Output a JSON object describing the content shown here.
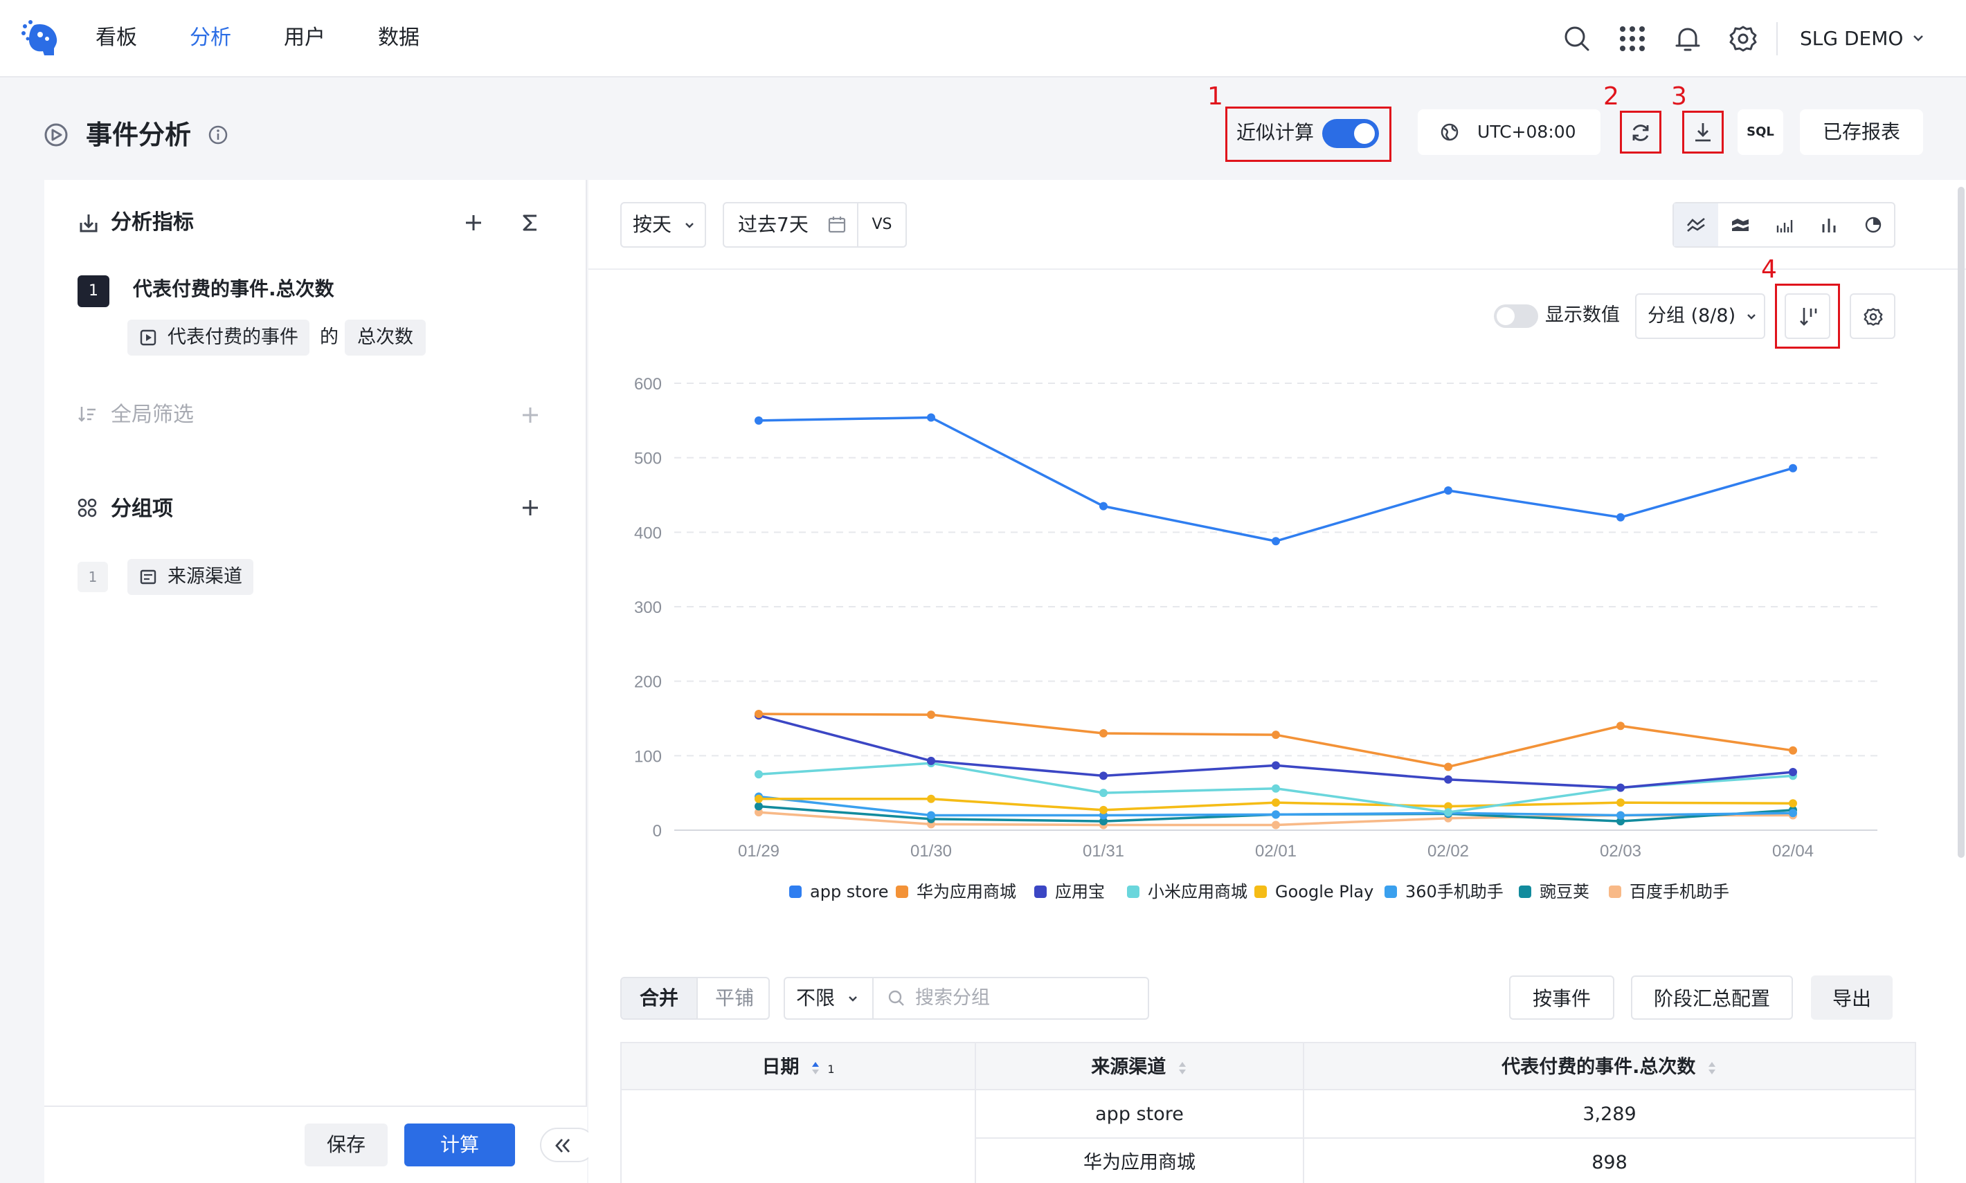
{
  "nav": {
    "items": [
      "看板",
      "分析",
      "用户",
      "数据"
    ],
    "active_index": 1,
    "user": "SLG DEMO"
  },
  "header": {
    "title": "事件分析",
    "approx_label": "近似计算",
    "approx_on": true,
    "timezone": "UTC+08:00",
    "sql_label": "SQL",
    "saved_reports": "已存报表"
  },
  "annotations": [
    "1",
    "2",
    "3",
    "4"
  ],
  "left": {
    "metrics_title": "分析指标",
    "metric_index": "1",
    "metric_name": "代表付费的事件.总次数",
    "metric_event": "代表付费的事件",
    "metric_of": "的",
    "metric_agg": "总次数",
    "filter_title": "全局筛选",
    "group_title": "分组项",
    "group_index": "1",
    "group_field": "来源渠道",
    "save": "保存",
    "calc": "计算"
  },
  "toolbar": {
    "granularity": "按天",
    "range": "过去7天",
    "vs": "VS"
  },
  "chart_controls": {
    "show_values": "显示数值",
    "show_values_on": false,
    "group_selector": "分组 (8/8)"
  },
  "chart_data": {
    "type": "line",
    "categories": [
      "01/29",
      "01/30",
      "01/31",
      "02/01",
      "02/02",
      "02/03",
      "02/04"
    ],
    "ylim": [
      0,
      600
    ],
    "yticks": [
      0,
      100,
      200,
      300,
      400,
      500,
      600
    ],
    "grid": true,
    "legend": "bottom",
    "series": [
      {
        "name": "app store",
        "color": "#2f7ef0",
        "values": [
          550,
          554,
          435,
          388,
          456,
          420,
          486
        ]
      },
      {
        "name": "华为应用商城",
        "color": "#f39237",
        "values": [
          156,
          155,
          130,
          128,
          85,
          140,
          107
        ]
      },
      {
        "name": "应用宝",
        "color": "#3b46c4",
        "values": [
          154,
          93,
          73,
          87,
          68,
          57,
          78
        ]
      },
      {
        "name": "小米应用商城",
        "color": "#6ad6dc",
        "values": [
          75,
          90,
          50,
          56,
          24,
          57,
          73
        ]
      },
      {
        "name": "Google Play",
        "color": "#f5bc16",
        "values": [
          42,
          42,
          27,
          37,
          32,
          37,
          36
        ]
      },
      {
        "name": "360手机助手",
        "color": "#3aa0ee",
        "values": [
          45,
          20,
          20,
          21,
          23,
          20,
          23
        ]
      },
      {
        "name": "豌豆荚",
        "color": "#128b9d",
        "values": [
          32,
          15,
          12,
          21,
          22,
          12,
          27
        ]
      },
      {
        "name": "百度手机助手",
        "color": "#f8b987",
        "values": [
          24,
          8,
          7,
          7,
          16,
          20,
          20
        ]
      }
    ]
  },
  "table_controls": {
    "tab_merge": "合并",
    "tab_tile": "平铺",
    "limit": "不限",
    "search_placeholder": "搜索分组",
    "by_event": "按事件",
    "stage_config": "阶段汇总配置",
    "export": "导出"
  },
  "table": {
    "headers": [
      "日期",
      "来源渠道",
      "代表付费的事件.总次数"
    ],
    "date_sort_index": "1",
    "rows": [
      {
        "channel": "app store",
        "value": "3,289"
      },
      {
        "channel": "华为应用商城",
        "value": "898"
      }
    ]
  }
}
